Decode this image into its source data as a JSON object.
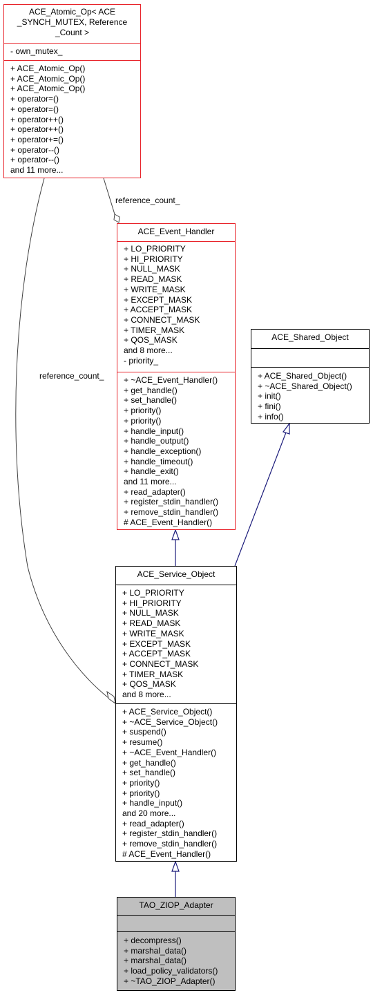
{
  "classes": {
    "atomic_op": {
      "title": "ACE_Atomic_Op< ACE\n_SYNCH_MUTEX, Reference\n_Count >",
      "title_lines": [
        "ACE_Atomic_Op< ACE",
        "_SYNCH_MUTEX, Reference",
        "_Count >"
      ],
      "attributes": [
        "- own_mutex_"
      ],
      "methods": [
        "+ ACE_Atomic_Op()",
        "+ ACE_Atomic_Op()",
        "+ ACE_Atomic_Op()",
        "+ operator=()",
        "+ operator=()",
        "+ operator++()",
        "+ operator++()",
        "+ operator+=()",
        "+ operator--()",
        "+ operator--()",
        "and 11 more..."
      ]
    },
    "event_handler": {
      "title": "ACE_Event_Handler",
      "attributes": [
        "+ LO_PRIORITY",
        "+ HI_PRIORITY",
        "+ NULL_MASK",
        "+ READ_MASK",
        "+ WRITE_MASK",
        "+ EXCEPT_MASK",
        "+ ACCEPT_MASK",
        "+ CONNECT_MASK",
        "+ TIMER_MASK",
        "+ QOS_MASK",
        "and 8 more...",
        "- priority_"
      ],
      "methods": [
        "+ ~ACE_Event_Handler()",
        "+ get_handle()",
        "+ set_handle()",
        "+ priority()",
        "+ priority()",
        "+ handle_input()",
        "+ handle_output()",
        "+ handle_exception()",
        "+ handle_timeout()",
        "+ handle_exit()",
        "and 11 more...",
        "+ read_adapter()",
        "+ register_stdin_handler()",
        "+ remove_stdin_handler()",
        "# ACE_Event_Handler()"
      ]
    },
    "shared_object": {
      "title": "ACE_Shared_Object",
      "attributes": [],
      "methods": [
        "+ ACE_Shared_Object()",
        "+ ~ACE_Shared_Object()",
        "+ init()",
        "+ fini()",
        "+ info()"
      ]
    },
    "service_object": {
      "title": "ACE_Service_Object",
      "attributes": [
        "+ LO_PRIORITY",
        "+ HI_PRIORITY",
        "+ NULL_MASK",
        "+ READ_MASK",
        "+ WRITE_MASK",
        "+ EXCEPT_MASK",
        "+ ACCEPT_MASK",
        "+ CONNECT_MASK",
        "+ TIMER_MASK",
        "+ QOS_MASK",
        "and 8 more..."
      ],
      "methods": [
        "+ ACE_Service_Object()",
        "+ ~ACE_Service_Object()",
        "+ suspend()",
        "+ resume()",
        "+ ~ACE_Event_Handler()",
        "+ get_handle()",
        "+ set_handle()",
        "+ priority()",
        "+ priority()",
        "+ handle_input()",
        "and 20 more...",
        "+ read_adapter()",
        "+ register_stdin_handler()",
        "+ remove_stdin_handler()",
        "# ACE_Event_Handler()"
      ]
    },
    "ziop_adapter": {
      "title": "TAO_ZIOP_Adapter",
      "attributes": [],
      "methods": [
        "+ decompress()",
        "+ marshal_data()",
        "+ marshal_data()",
        "+ load_policy_validators()",
        "+ ~TAO_ZIOP_Adapter()"
      ]
    }
  },
  "edges": {
    "label_top": "reference_count_",
    "label_left": "reference_count_"
  },
  "colors": {
    "highlight_border": "#e8232a",
    "inheritance_arrow": "#1a1a7a",
    "composition_line": "#404040",
    "focus_fill": "#bfbfbf"
  }
}
